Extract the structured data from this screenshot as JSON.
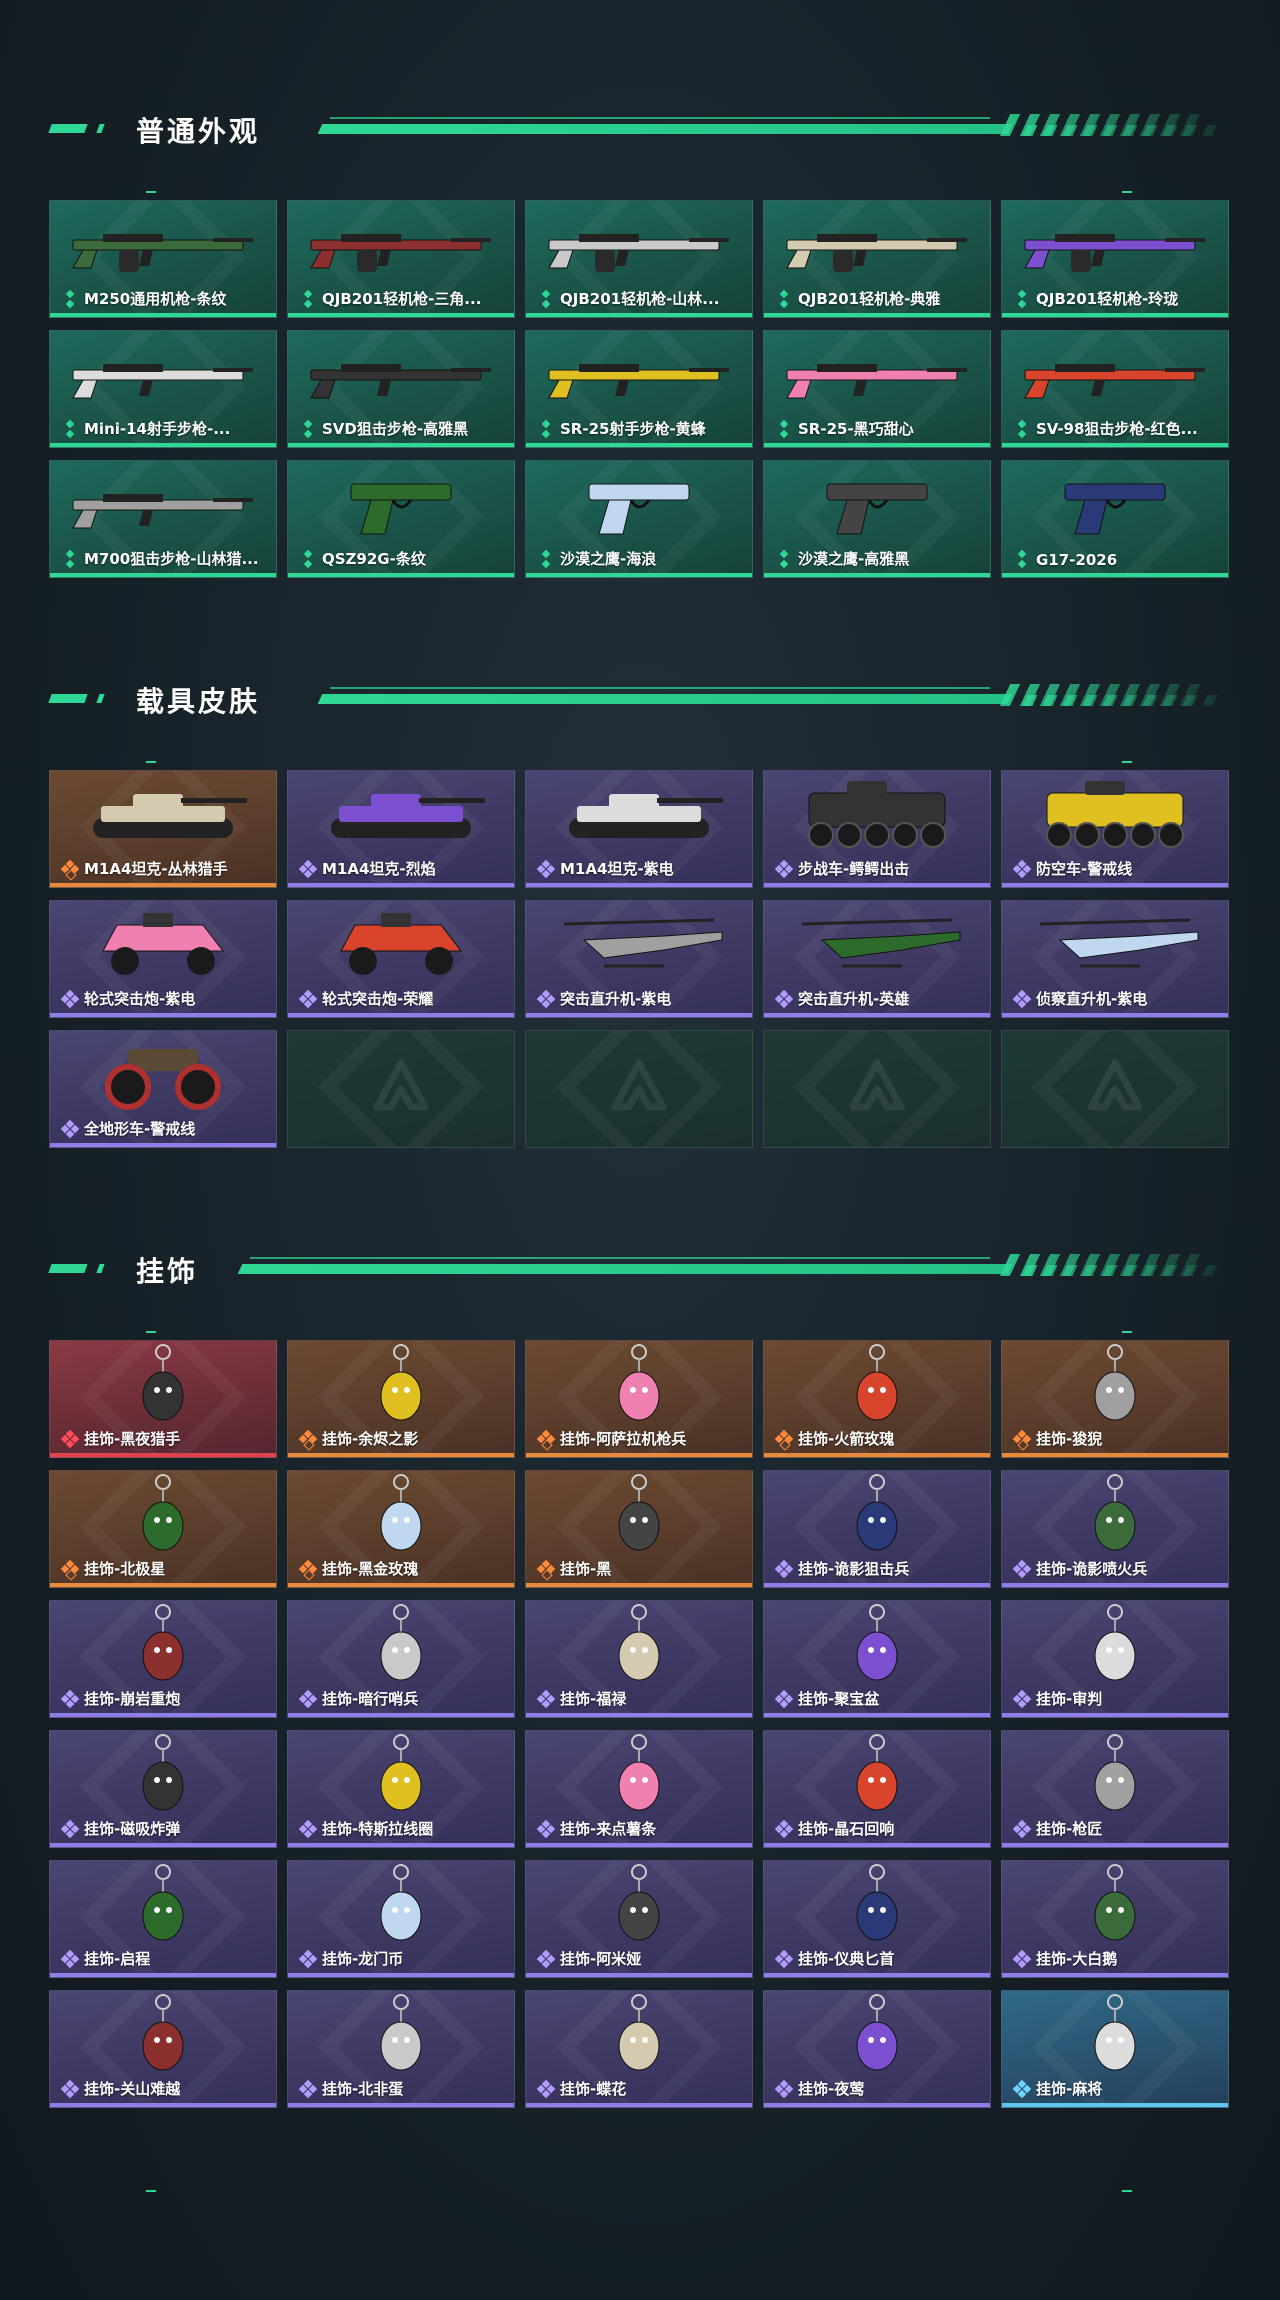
{
  "sections": [
    {
      "title": "普通外观",
      "items": [
        {
          "label": "M250通用机枪-条纹",
          "rarity": "green",
          "icon": "machine-gun-icon"
        },
        {
          "label": "QJB201轻机枪-三角...",
          "rarity": "green",
          "icon": "machine-gun-icon"
        },
        {
          "label": "QJB201轻机枪-山林...",
          "rarity": "green",
          "icon": "machine-gun-icon"
        },
        {
          "label": "QJB201轻机枪-典雅",
          "rarity": "green",
          "icon": "machine-gun-icon"
        },
        {
          "label": "QJB201轻机枪-玲珑",
          "rarity": "green",
          "icon": "machine-gun-icon"
        },
        {
          "label": "Mini-14射手步枪-...",
          "rarity": "green",
          "icon": "rifle-icon"
        },
        {
          "label": "SVD狙击步枪-高雅黑",
          "rarity": "green",
          "icon": "rifle-icon"
        },
        {
          "label": "SR-25射手步枪-黄蜂",
          "rarity": "green",
          "icon": "rifle-icon"
        },
        {
          "label": "SR-25-黑巧甜心",
          "rarity": "green",
          "icon": "rifle-icon"
        },
        {
          "label": "SV-98狙击步枪-红色...",
          "rarity": "green",
          "icon": "rifle-icon"
        },
        {
          "label": "M700狙击步枪-山林猎...",
          "rarity": "green",
          "icon": "rifle-icon"
        },
        {
          "label": "QSZ92G-条纹",
          "rarity": "green",
          "icon": "pistol-icon"
        },
        {
          "label": "沙漠之鹰-海浪",
          "rarity": "green",
          "icon": "pistol-icon"
        },
        {
          "label": "沙漠之鹰-高雅黑",
          "rarity": "green",
          "icon": "pistol-icon"
        },
        {
          "label": "G17-2026",
          "rarity": "green",
          "icon": "pistol-icon"
        }
      ]
    },
    {
      "title": "载具皮肤",
      "items": [
        {
          "label": "M1A4坦克-丛林猎手",
          "rarity": "orange",
          "icon": "tank-icon"
        },
        {
          "label": "M1A4坦克-烈焰",
          "rarity": "purple",
          "icon": "tank-icon"
        },
        {
          "label": "M1A4坦克-紫电",
          "rarity": "purple",
          "icon": "tank-icon"
        },
        {
          "label": "步战车-鳄鳄出击",
          "rarity": "purple",
          "icon": "ifv-icon"
        },
        {
          "label": "防空车-警戒线",
          "rarity": "purple",
          "icon": "ifv-icon"
        },
        {
          "label": "轮式突击炮-紫电",
          "rarity": "purple",
          "icon": "armored-car-icon"
        },
        {
          "label": "轮式突击炮-荣耀",
          "rarity": "purple",
          "icon": "armored-car-icon"
        },
        {
          "label": "突击直升机-紫电",
          "rarity": "purple",
          "icon": "helicopter-icon"
        },
        {
          "label": "突击直升机-英雄",
          "rarity": "purple",
          "icon": "helicopter-icon"
        },
        {
          "label": "侦察直升机-紫电",
          "rarity": "purple",
          "icon": "helicopter-icon"
        },
        {
          "label": "全地形车-警戒线",
          "rarity": "purple",
          "icon": "atv-icon"
        },
        {
          "label": "",
          "rarity": "empty",
          "icon": "placeholder-logo-icon"
        },
        {
          "label": "",
          "rarity": "empty",
          "icon": "placeholder-logo-icon"
        },
        {
          "label": "",
          "rarity": "empty",
          "icon": "placeholder-logo-icon"
        },
        {
          "label": "",
          "rarity": "empty",
          "icon": "placeholder-logo-icon"
        }
      ]
    },
    {
      "title": "挂饰",
      "items": [
        {
          "label": "挂饰-黑夜猎手",
          "rarity": "red",
          "icon": "charm-icon"
        },
        {
          "label": "挂饰-余烬之影",
          "rarity": "orange",
          "icon": "charm-icon"
        },
        {
          "label": "挂饰-阿萨拉机枪兵",
          "rarity": "orange",
          "icon": "charm-icon"
        },
        {
          "label": "挂饰-火箭玫瑰",
          "rarity": "orange",
          "icon": "charm-icon"
        },
        {
          "label": "挂饰-狻猊",
          "rarity": "orange",
          "icon": "charm-icon"
        },
        {
          "label": "挂饰-北极星",
          "rarity": "orange",
          "icon": "charm-icon"
        },
        {
          "label": "挂饰-黑金玫瑰",
          "rarity": "orange",
          "icon": "charm-icon"
        },
        {
          "label": "挂饰-黑",
          "rarity": "orange",
          "icon": "charm-icon"
        },
        {
          "label": "挂饰-诡影狙击兵",
          "rarity": "purple",
          "icon": "charm-icon"
        },
        {
          "label": "挂饰-诡影喷火兵",
          "rarity": "purple",
          "icon": "charm-icon"
        },
        {
          "label": "挂饰-崩岩重炮",
          "rarity": "purple",
          "icon": "charm-icon"
        },
        {
          "label": "挂饰-暗行哨兵",
          "rarity": "purple",
          "icon": "charm-icon"
        },
        {
          "label": "挂饰-福禄",
          "rarity": "purple",
          "icon": "charm-icon"
        },
        {
          "label": "挂饰-聚宝盆",
          "rarity": "purple",
          "icon": "charm-icon"
        },
        {
          "label": "挂饰-审判",
          "rarity": "purple",
          "icon": "charm-icon"
        },
        {
          "label": "挂饰-磁吸炸弹",
          "rarity": "purple",
          "icon": "charm-icon"
        },
        {
          "label": "挂饰-特斯拉线圈",
          "rarity": "purple",
          "icon": "charm-icon"
        },
        {
          "label": "挂饰-来点薯条",
          "rarity": "purple",
          "icon": "charm-icon"
        },
        {
          "label": "挂饰-晶石回响",
          "rarity": "purple",
          "icon": "charm-icon"
        },
        {
          "label": "挂饰-枪匠",
          "rarity": "purple",
          "icon": "charm-icon"
        },
        {
          "label": "挂饰-启程",
          "rarity": "purple",
          "icon": "charm-icon"
        },
        {
          "label": "挂饰-龙门币",
          "rarity": "purple",
          "icon": "charm-icon"
        },
        {
          "label": "挂饰-阿米娅",
          "rarity": "purple",
          "icon": "charm-icon"
        },
        {
          "label": "挂饰-仪典匕首",
          "rarity": "purple",
          "icon": "charm-icon"
        },
        {
          "label": "挂饰-大白鹅",
          "rarity": "purple",
          "icon": "charm-icon"
        },
        {
          "label": "挂饰-关山难越",
          "rarity": "purple",
          "icon": "charm-icon"
        },
        {
          "label": "挂饰-北非蛋",
          "rarity": "purple",
          "icon": "charm-icon"
        },
        {
          "label": "挂饰-蝶花",
          "rarity": "purple",
          "icon": "charm-icon"
        },
        {
          "label": "挂饰-夜莺",
          "rarity": "purple",
          "icon": "charm-icon"
        },
        {
          "label": "挂饰-麻将",
          "rarity": "blue",
          "icon": "charm-icon"
        }
      ]
    }
  ],
  "colors": {
    "accent": "#2fd995",
    "green_quality": "#2fd995",
    "orange_quality": "#e88a3c",
    "purple_quality": "#8f7dea",
    "red_quality": "#e0424e",
    "blue_quality": "#5cc6ef"
  }
}
